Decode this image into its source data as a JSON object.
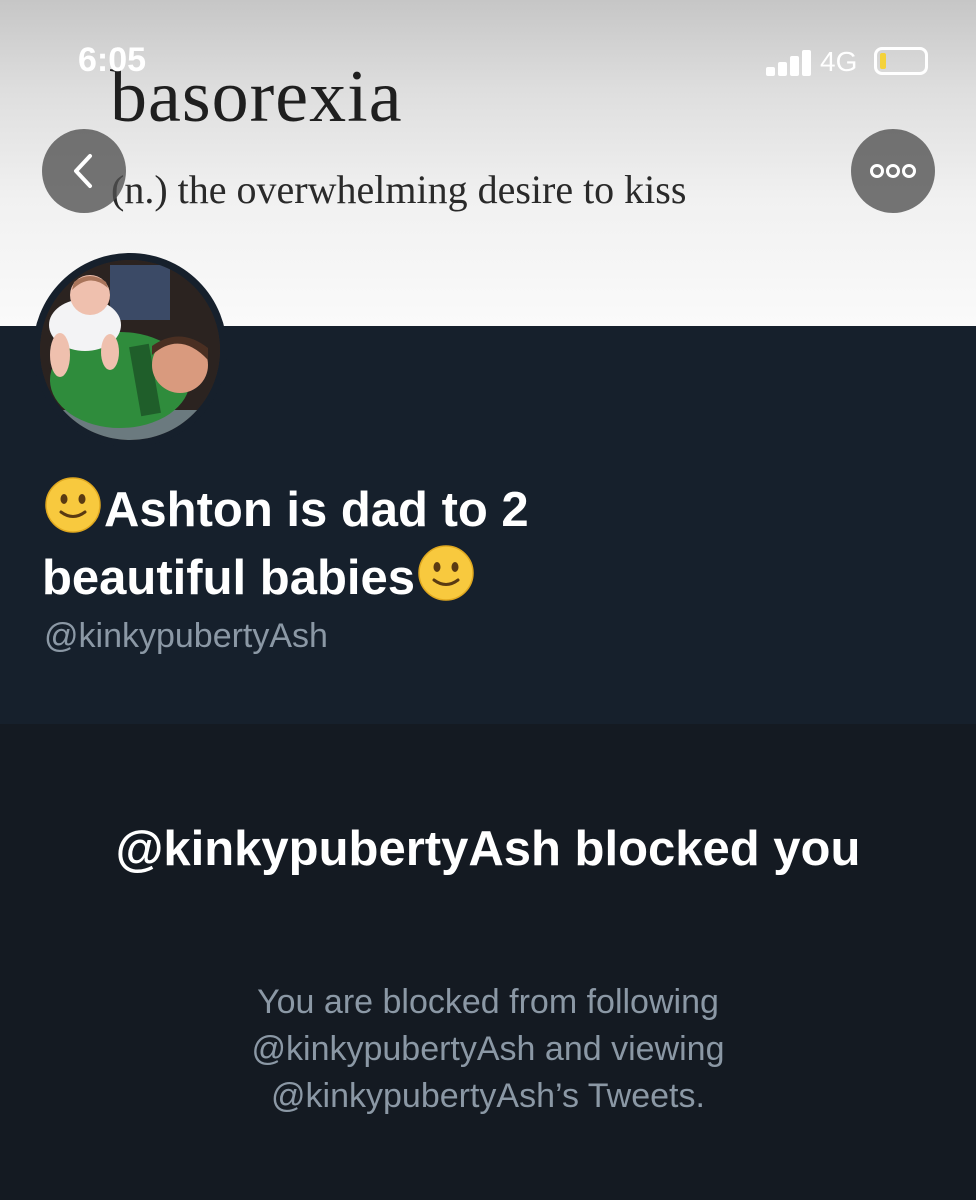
{
  "status_bar": {
    "time": "6:05",
    "network": "4G",
    "icons": [
      "signal-icon",
      "battery-icon"
    ],
    "battery_color": "#f4d23a"
  },
  "banner": {
    "word": "basorexia",
    "definition": "(n.) the overwhelming desire to kiss"
  },
  "nav": {
    "back_icon": "chevron-left-icon",
    "more_icon": "more-dots-icon"
  },
  "profile": {
    "name_part1": "Ashton is dad to 2",
    "name_part2": "beautiful babies",
    "name_emoji": "slightly-smiling-face",
    "handle": "@kinkypubertyAsh"
  },
  "blocked": {
    "title": "@kinkypubertyAsh blocked you",
    "body": "You are blocked from following @kinkypubertyAsh and viewing @kinkypubertyAsh’s Tweets."
  },
  "colors": {
    "profile_bg": "#16202c",
    "page_bg": "#141a22",
    "secondary_text": "#8b98a5"
  }
}
